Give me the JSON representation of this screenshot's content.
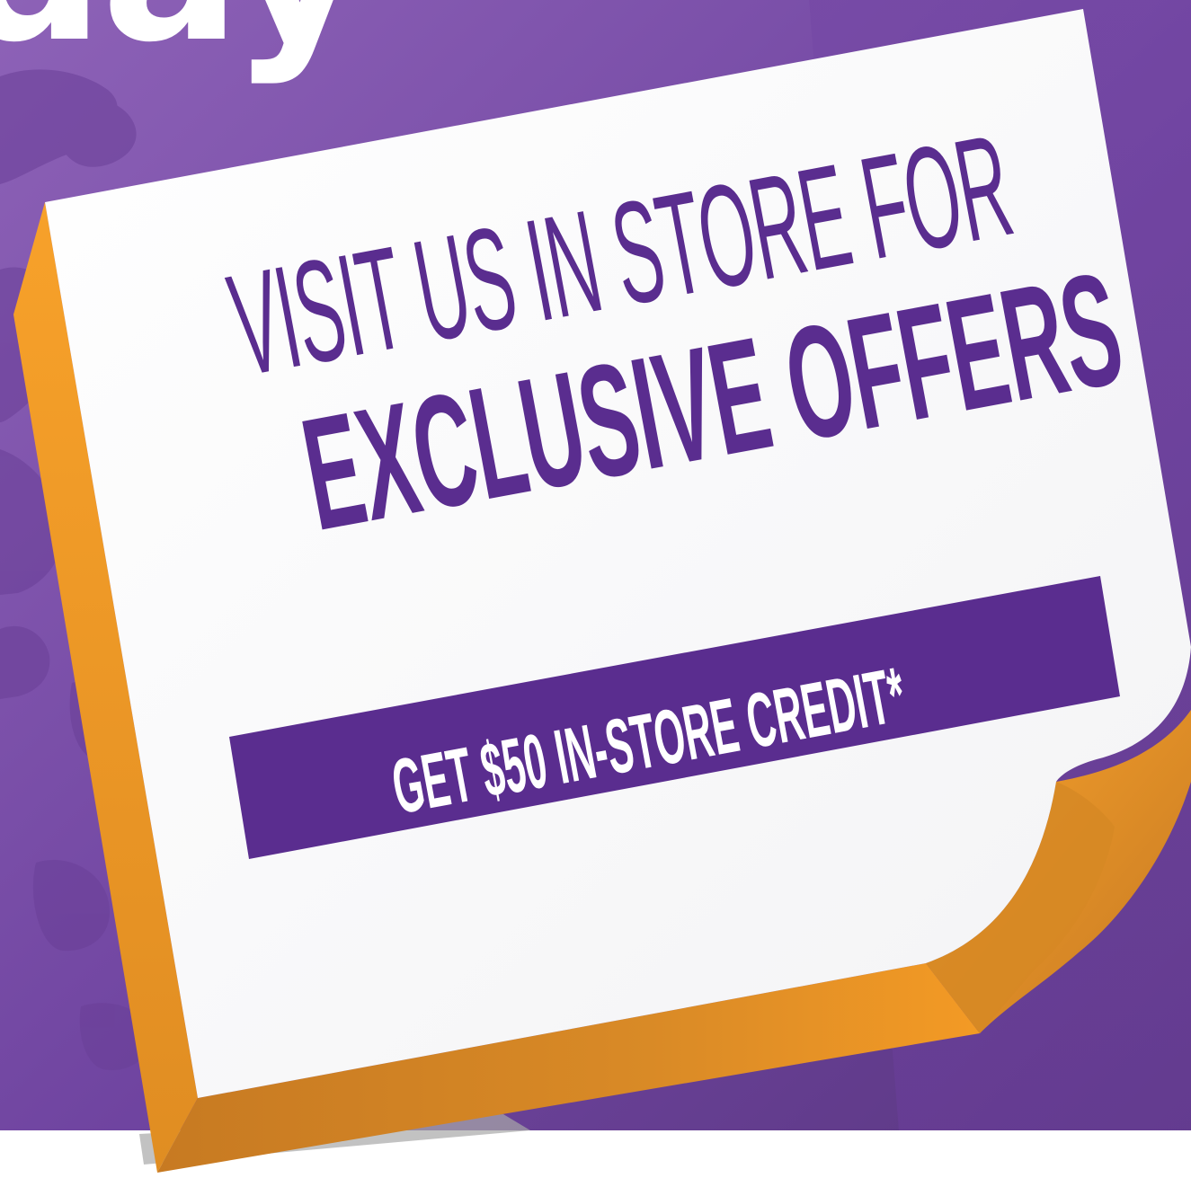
{
  "colors": {
    "background_purple": "#7b51a7",
    "background_purple_dark": "#5b3882",
    "banner_purple": "#5a2d8f",
    "card_white": "#fdfdfd",
    "card_edge_orange": "#f39a25",
    "card_edge_orange_dark": "#c77a22"
  },
  "background": {
    "headline_fragment": "day"
  },
  "offer": {
    "line1": "VISIT US IN STORE FOR",
    "line2": "EXCLUSIVE OFFERS",
    "banner_text": "GET $50 IN-STORE CREDIT*"
  }
}
